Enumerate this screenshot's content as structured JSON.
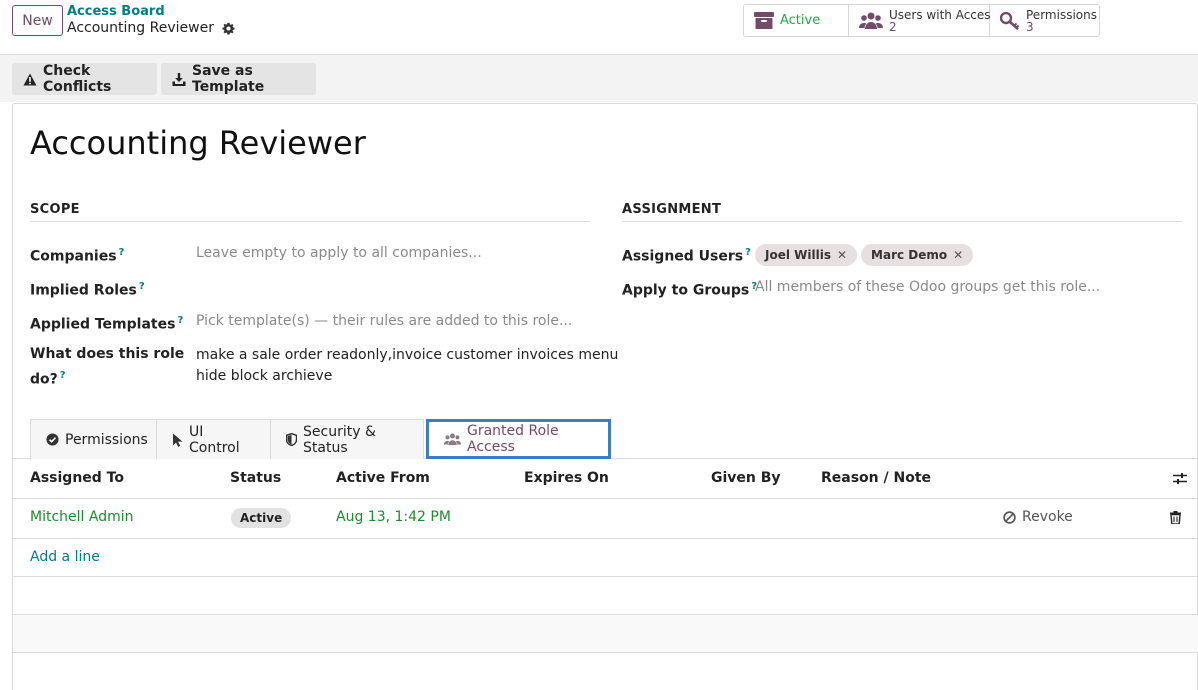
{
  "control_panel": {
    "new_button": "New",
    "breadcrumb_parent": "Access Board",
    "breadcrumb_current": "Accounting Reviewer"
  },
  "stat_buttons": {
    "status": "Active",
    "users_label": "Users with Access",
    "users_count": "2",
    "permissions_label": "Permissions",
    "permissions_count": "3"
  },
  "actions": {
    "check_conflicts": "Check Conflicts",
    "save_template": "Save as Template"
  },
  "record": {
    "title": "Accounting Reviewer"
  },
  "scope": {
    "heading": "SCOPE",
    "companies_label": "Companies",
    "companies_placeholder": "Leave empty to apply to all companies...",
    "implied_roles_label": "Implied Roles",
    "templates_label": "Applied Templates",
    "templates_placeholder": "Pick template(s) — their rules are added to this role...",
    "what_label_1": "What does this role",
    "what_label_2": "do?",
    "what_value_1": "make a sale order readonly,invoice customer invoices menu",
    "what_value_2": "hide block archieve"
  },
  "assignment": {
    "heading": "ASSIGNMENT",
    "users_label": "Assigned Users",
    "users": [
      "Joel Willis",
      "Marc Demo"
    ],
    "groups_label": "Apply to Groups",
    "groups_placeholder": "All members of these Odoo groups get this role..."
  },
  "help_marker": "?",
  "tabs": [
    "Permissions",
    "UI Control",
    "Security & Status",
    "Granted Role Access"
  ],
  "table": {
    "headers": [
      "Assigned To",
      "Status",
      "Active From",
      "Expires On",
      "Given By",
      "Reason / Note"
    ],
    "rows": [
      {
        "assigned_to": "Mitchell Admin",
        "status": "Active",
        "active_from": "Aug 13, 1:42 PM",
        "action": "Revoke"
      }
    ],
    "add_line": "Add a line"
  },
  "colors": {
    "brand": "#714b67",
    "teal": "#017e84",
    "green": "#28a745",
    "tab_highlight": "#3f7cc5"
  }
}
